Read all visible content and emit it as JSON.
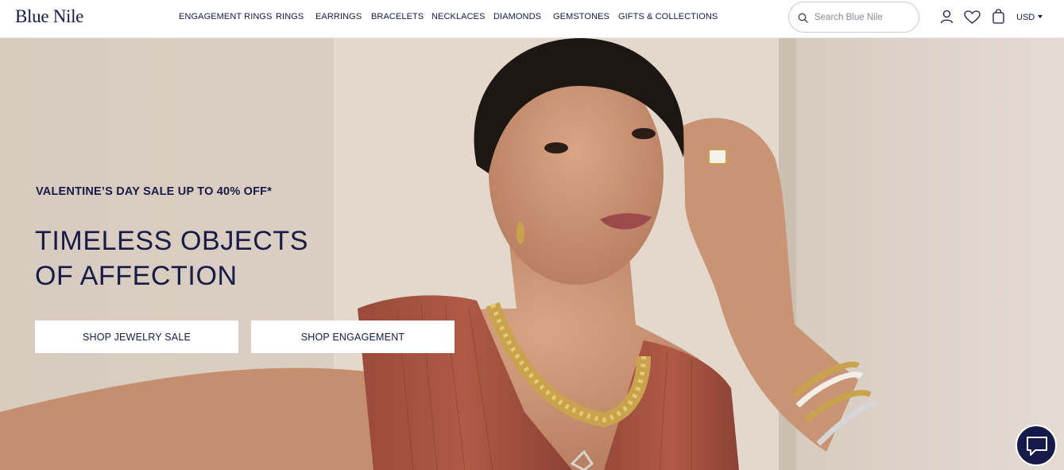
{
  "brand": {
    "logo": "Blue Nile"
  },
  "nav": {
    "items": [
      {
        "label": "ENGAGEMENT RINGS"
      },
      {
        "label": "RINGS"
      },
      {
        "label": "EARRINGS"
      },
      {
        "label": "BRACELETS"
      },
      {
        "label": "NECKLACES"
      },
      {
        "label": "DIAMONDS"
      },
      {
        "label": "GEMSTONES"
      },
      {
        "label": "GIFTS & COLLECTIONS"
      }
    ]
  },
  "search": {
    "placeholder": "Search Blue Nile",
    "value": ""
  },
  "header_icons": [
    "user-icon",
    "heart-icon",
    "bag-icon"
  ],
  "currency": {
    "label": "USD"
  },
  "hero": {
    "eyebrow": "VALENTINE’S DAY SALE UP TO 40% OFF*",
    "headline_line1": "TIMELESS OBJECTS",
    "headline_line2": "OF AFFECTION",
    "cta_primary": "SHOP JEWELRY SALE",
    "cta_secondary": "SHOP ENGAGEMENT"
  },
  "chat": {
    "icon": "chat-icon"
  },
  "colors": {
    "brand_navy": "#141a4a",
    "hero_bg": "#d9cdc0",
    "dress": "#a0503f"
  }
}
